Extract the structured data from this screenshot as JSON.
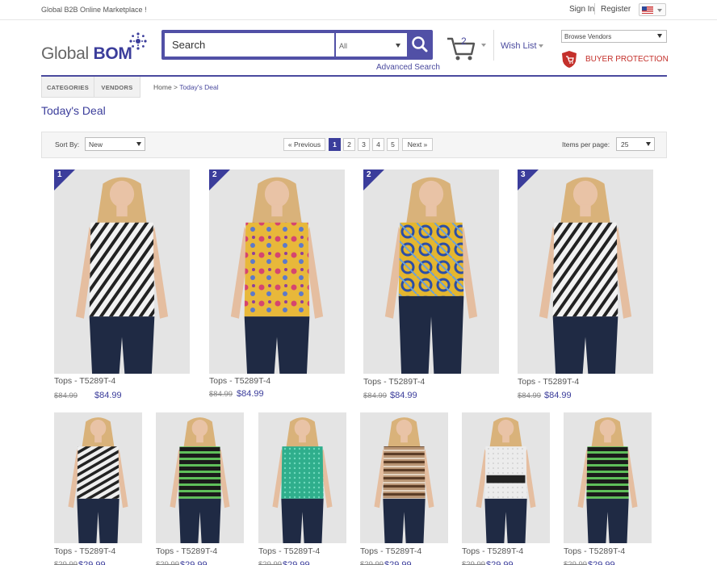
{
  "top": {
    "tagline": "Global B2B Online Marketplace !",
    "signin": "Sign In",
    "register": "Register"
  },
  "header": {
    "logo_a": "Global ",
    "logo_b": "BOM",
    "search_placeholder": "Search",
    "search_category": "All",
    "advanced_search": "Advanced Search",
    "cart_count": "2",
    "wish_list": "Wish List",
    "browse_vendors": "Browse Vendors",
    "buyer_protection": "BUYER PROTECTION"
  },
  "nav": {
    "tab_categories": "CATEGORIES",
    "tab_vendors": "VENDORS",
    "crumb_home": "Home",
    "crumb_sep": " > ",
    "crumb_current": "Today's Deal"
  },
  "page_title": "Today's Deal",
  "toolbar": {
    "sort_label": "Sort By:",
    "sort_value": "New",
    "prev": "« Previous",
    "next": "Next »",
    "pages": [
      "1",
      "2",
      "3",
      "4",
      "5"
    ],
    "current_page": "1",
    "items_label": "Items per page:",
    "items_value": "25"
  },
  "colors": {
    "accent": "#3b3d9b",
    "search": "#5150a6",
    "protection": "#c4302b"
  },
  "products": [
    {
      "rank": "1",
      "name": "Tops - T5289T-4",
      "old_price": "$84.99",
      "price": "$84.99",
      "top": "zebra"
    },
    {
      "rank": "2",
      "name": "Tops - T5289T-4",
      "old_price": "$84.99",
      "price": "$84.99",
      "top": "floral"
    },
    {
      "rank": "2",
      "name": "Tops - T5289T-4",
      "old_price": "$84.99",
      "price": "$84.99",
      "top": "scarf"
    },
    {
      "rank": "3",
      "name": "Tops - T5289T-4",
      "old_price": "$84.99",
      "price": "$84.99",
      "top": "zebra"
    },
    {
      "rank": "",
      "name": "Tops - T5289T-4",
      "old_price": "$29.99",
      "price": "$29.99",
      "top": "bw-stripe"
    },
    {
      "rank": "",
      "name": "Tops - T5289T-4",
      "old_price": "$29.99",
      "price": "$29.99",
      "top": "green-stripe"
    },
    {
      "rank": "",
      "name": "Tops - T5289T-4",
      "old_price": "$29.99",
      "price": "$29.99",
      "top": "teal-lace"
    },
    {
      "rank": "",
      "name": "Tops - T5289T-4",
      "old_price": "$29.99",
      "price": "$29.99",
      "top": "brown-knit"
    },
    {
      "rank": "",
      "name": "Tops - T5289T-4",
      "old_price": "$29.99",
      "price": "$29.99",
      "top": "white-belt"
    },
    {
      "rank": "",
      "name": "Tops - T5289T-4",
      "old_price": "$29.99",
      "price": "$29.99",
      "top": "green-stripe"
    }
  ]
}
